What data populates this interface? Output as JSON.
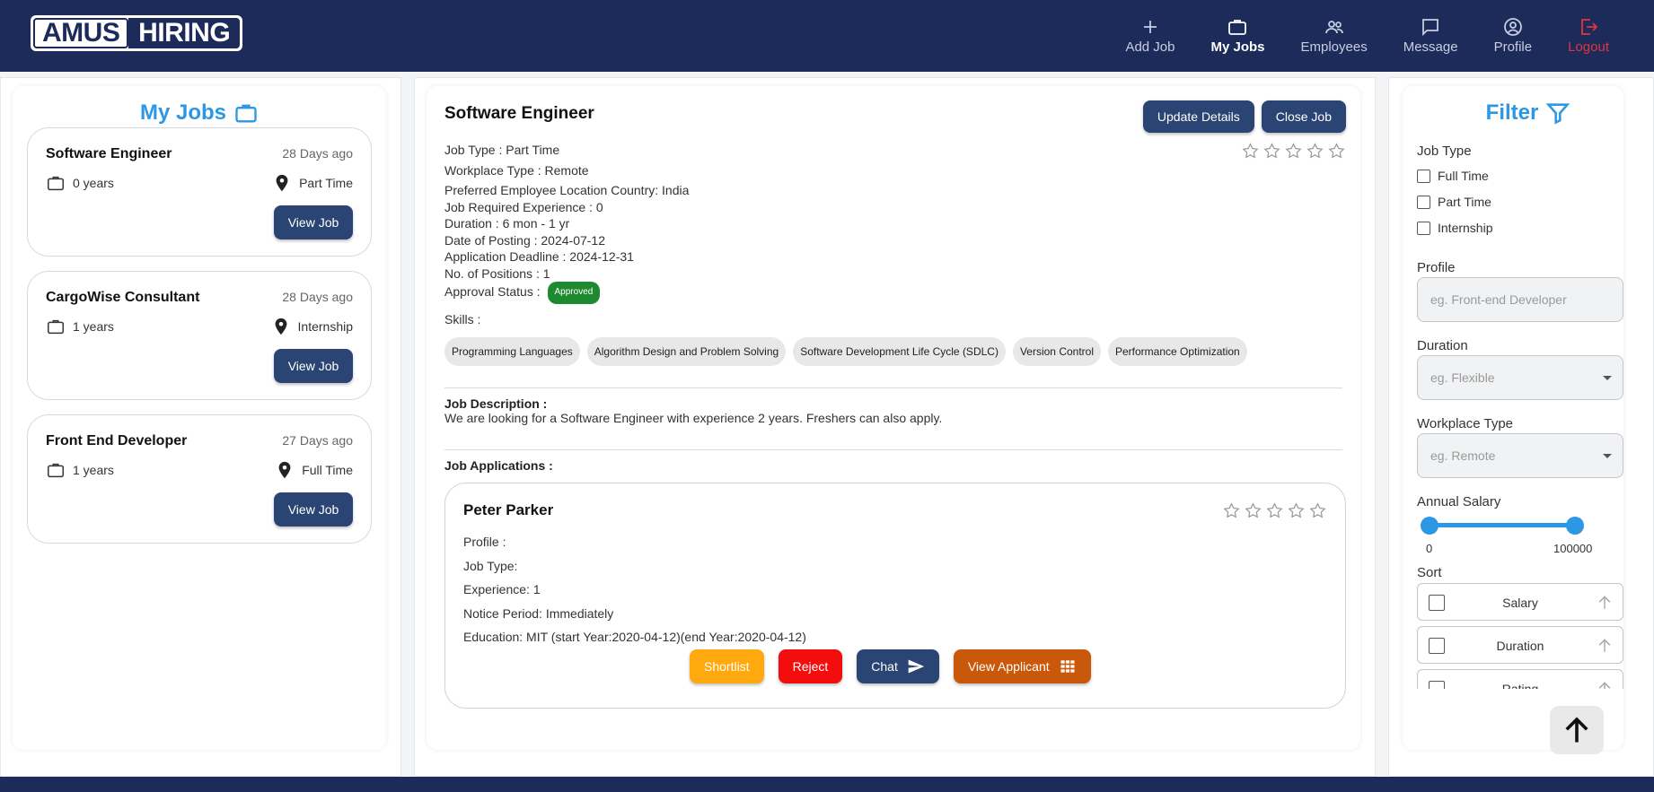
{
  "header": {
    "logo_left": "AMUS",
    "logo_right": "HIRING",
    "nav": [
      {
        "label": "Add Job",
        "icon": "plus-icon"
      },
      {
        "label": "My Jobs",
        "icon": "briefcase-icon"
      },
      {
        "label": "Employees",
        "icon": "people-icon"
      },
      {
        "label": "Message",
        "icon": "message-icon"
      },
      {
        "label": "Profile",
        "icon": "user-circle-icon"
      },
      {
        "label": "Logout",
        "icon": "logout-icon"
      }
    ]
  },
  "left": {
    "title": "My Jobs",
    "jobs": [
      {
        "title": "Software Engineer",
        "ago": "28 Days ago",
        "experience": "0 years",
        "type": "Part Time",
        "button": "View Job"
      },
      {
        "title": "CargoWise Consultant",
        "ago": "28 Days ago",
        "experience": "1 years",
        "type": "Internship",
        "button": "View Job"
      },
      {
        "title": "Front End Developer",
        "ago": "27 Days ago",
        "experience": "1 years",
        "type": "Full Time",
        "button": "View Job"
      }
    ]
  },
  "detail": {
    "title": "Software Engineer",
    "update_button": "Update Details",
    "close_button": "Close Job",
    "lines": [
      "Job Type : Part Time",
      "Workplace Type : Remote",
      "Preferred Employee Location Country: India",
      "Job Required Experience : 0",
      "Duration : 6 mon - 1 yr",
      "Date of Posting : 2024-07-12",
      "Application Deadline : 2024-12-31",
      "No. of Positions : 1"
    ],
    "approval_label": "Approval Status :",
    "approval_value": "Approved",
    "skills_label": "Skills :",
    "skills": [
      "Programming Languages",
      "Algorithm Design and Problem Solving",
      "Software Development Life Cycle (SDLC)",
      "Version Control",
      "Performance Optimization"
    ],
    "description_label": "Job Description :",
    "description": "We are looking for a Software Engineer with experience 2 years. Freshers can also apply.",
    "applications_label": "Job Applications :",
    "rating": 0
  },
  "application": {
    "name": "Peter Parker",
    "lines": [
      "Profile :",
      "Job Type:",
      "Experience: 1",
      "Notice Period: Immediately",
      "Education: MIT (start Year:2020-04-12)(end Year:2020-04-12)"
    ],
    "shortlist": "Shortlist",
    "reject": "Reject",
    "chat": "Chat",
    "view": "View Applicant",
    "rating": 0
  },
  "filter": {
    "title": "Filter",
    "job_type_label": "Job Type",
    "job_types": [
      "Full Time",
      "Part Time",
      "Internship"
    ],
    "profile_label": "Profile",
    "profile_placeholder": "eg. Front-end Developer",
    "duration_label": "Duration",
    "duration_placeholder": "eg. Flexible",
    "workplace_label": "Workplace Type",
    "workplace_placeholder": "eg. Remote",
    "salary_label": "Annual Salary",
    "salary_min": "0",
    "salary_max": "100000",
    "sort_label": "Sort",
    "sort_options": [
      "Salary",
      "Duration",
      "Rating"
    ]
  },
  "colors": {
    "navy": "#1c2b5a",
    "accent_blue": "#2c97e4",
    "button_dark": "#2a4473",
    "approved_green": "#1e8a2f",
    "shortlist": "#ffa90e",
    "reject": "#f40d0d",
    "view_applicant": "#c9580a"
  }
}
